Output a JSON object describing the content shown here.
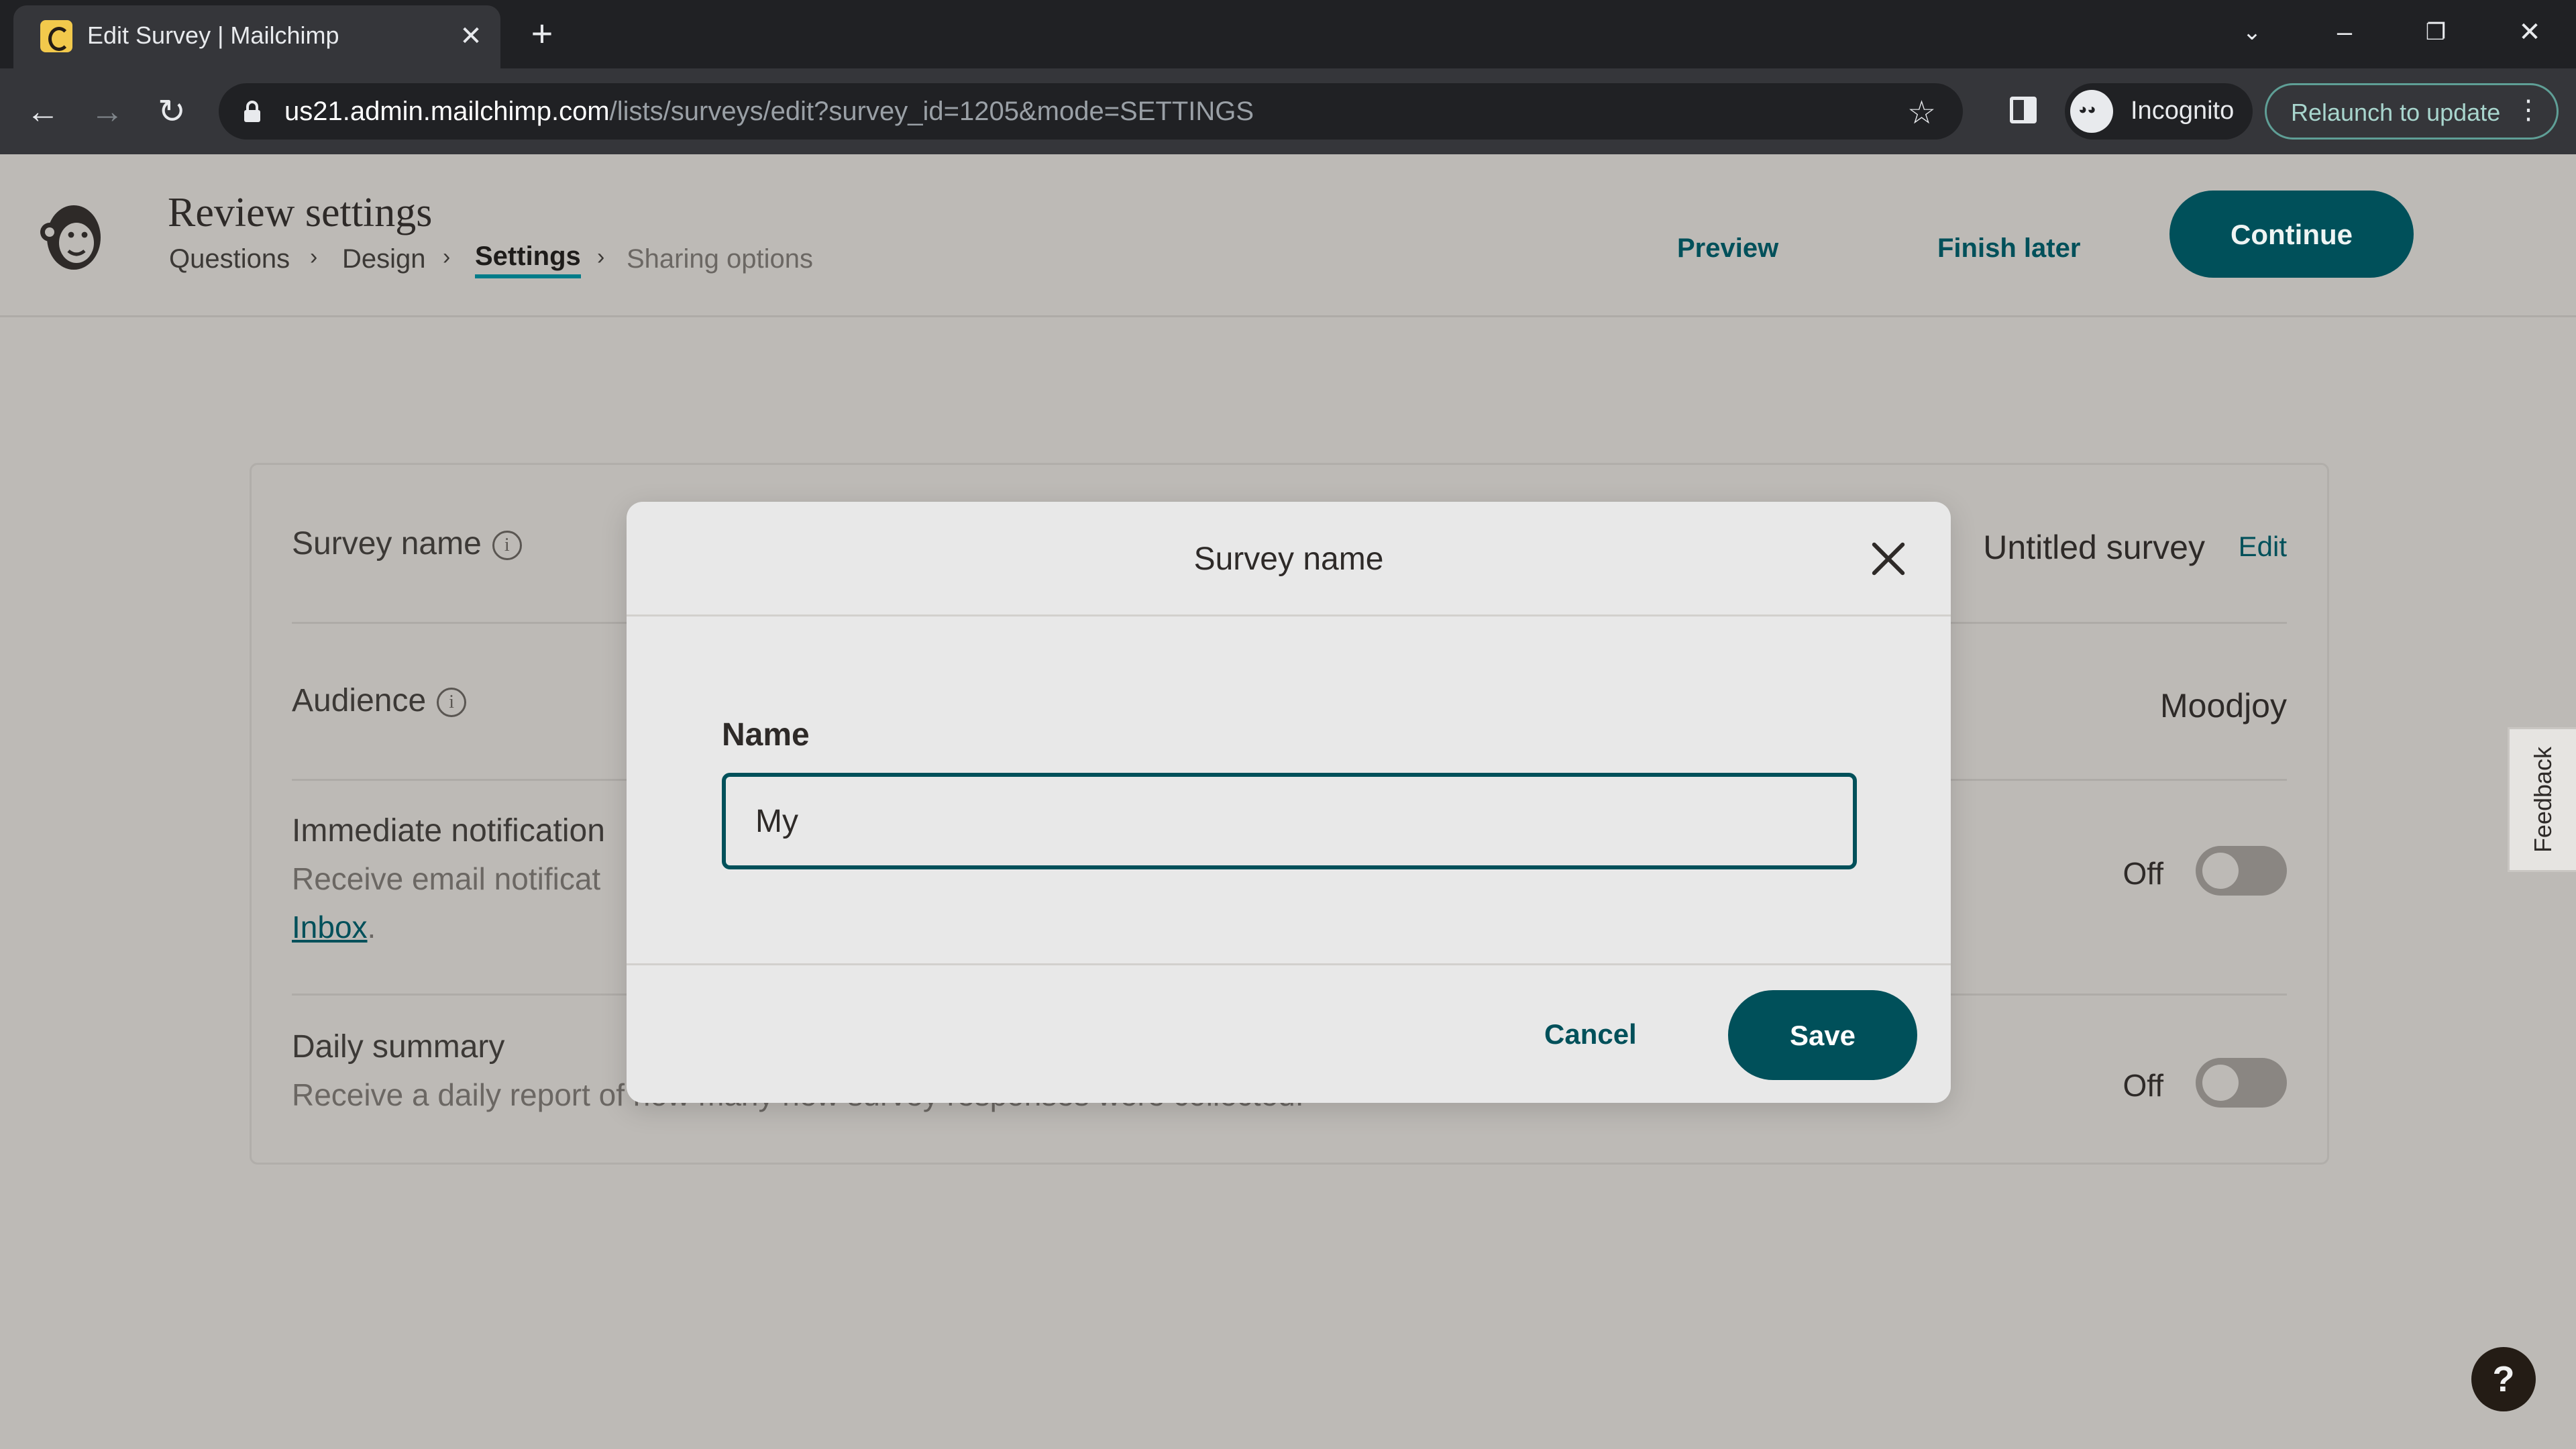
{
  "browser": {
    "tab_title": "Edit Survey | Mailchimp",
    "tab_close": "✕",
    "new_tab": "+",
    "url_host": "us21.admin.mailchimp.com",
    "url_path": "/lists/surveys/edit?survey_id=1205&mode=SETTINGS",
    "incognito_label": "Incognito",
    "relaunch_label": "Relaunch to update"
  },
  "header": {
    "title": "Review settings",
    "breadcrumbs": [
      "Questions",
      "Design",
      "Settings",
      "Sharing options"
    ],
    "active_step": "Settings",
    "preview_label": "Preview",
    "finish_later_label": "Finish later",
    "continue_label": "Continue"
  },
  "settings": {
    "survey_name": {
      "label": "Survey name",
      "value": "Untitled survey",
      "action": "Edit"
    },
    "audience": {
      "label": "Audience",
      "value": "Moodjoy"
    },
    "immediate_notifications": {
      "label": "Immediate notification",
      "description": "Receive email notificat",
      "link_text": "Inbox",
      "state": "Off"
    },
    "daily_summary": {
      "label": "Daily summary",
      "description": "Receive a daily report of how many new survey responses were collected.",
      "state": "Off"
    }
  },
  "modal": {
    "title": "Survey name",
    "field_label": "Name",
    "field_value": "My",
    "cancel_label": "Cancel",
    "save_label": "Save"
  },
  "feedback_label": "Feedback",
  "help_label": "?",
  "colors": {
    "brand_teal": "#00505a",
    "overlay_bg": "#bdbab6",
    "modal_bg": "#e8e8e8"
  }
}
